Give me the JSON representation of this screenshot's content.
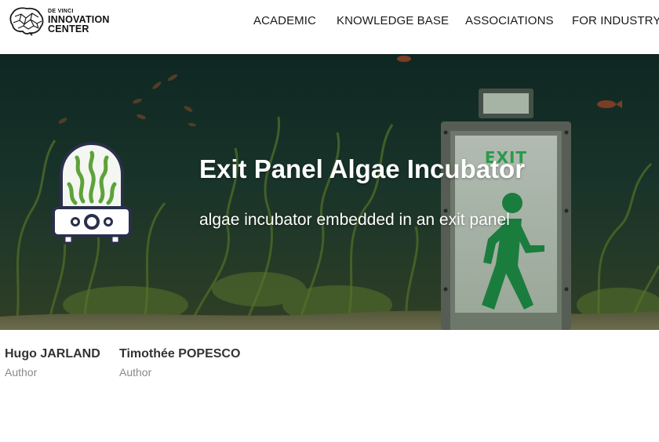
{
  "header": {
    "logo": {
      "line1": "DE VINCI",
      "line2": "INNOVATION",
      "line3": "CENTER",
      "icon": "brain-icon"
    },
    "nav": [
      {
        "label": "ACADEMIC"
      },
      {
        "label": "KNOWLEDGE BASE"
      },
      {
        "label": "ASSOCIATIONS"
      },
      {
        "label": "FOR INDUSTRY"
      }
    ]
  },
  "hero": {
    "title": "Exit Panel Algae Incubator",
    "subtitle": "algae incubator embedded in an exit panel",
    "exit_sign_text": "EXIT",
    "icon": "algae-incubator-icon",
    "colors": {
      "overlay": "#1f3a2c",
      "algae": "#6fa53a",
      "exit_green": "#1e9c4a"
    }
  },
  "authors": [
    {
      "name": "Hugo JARLAND",
      "role": "Author"
    },
    {
      "name": "Timothée POPESCO",
      "role": "Author"
    }
  ]
}
